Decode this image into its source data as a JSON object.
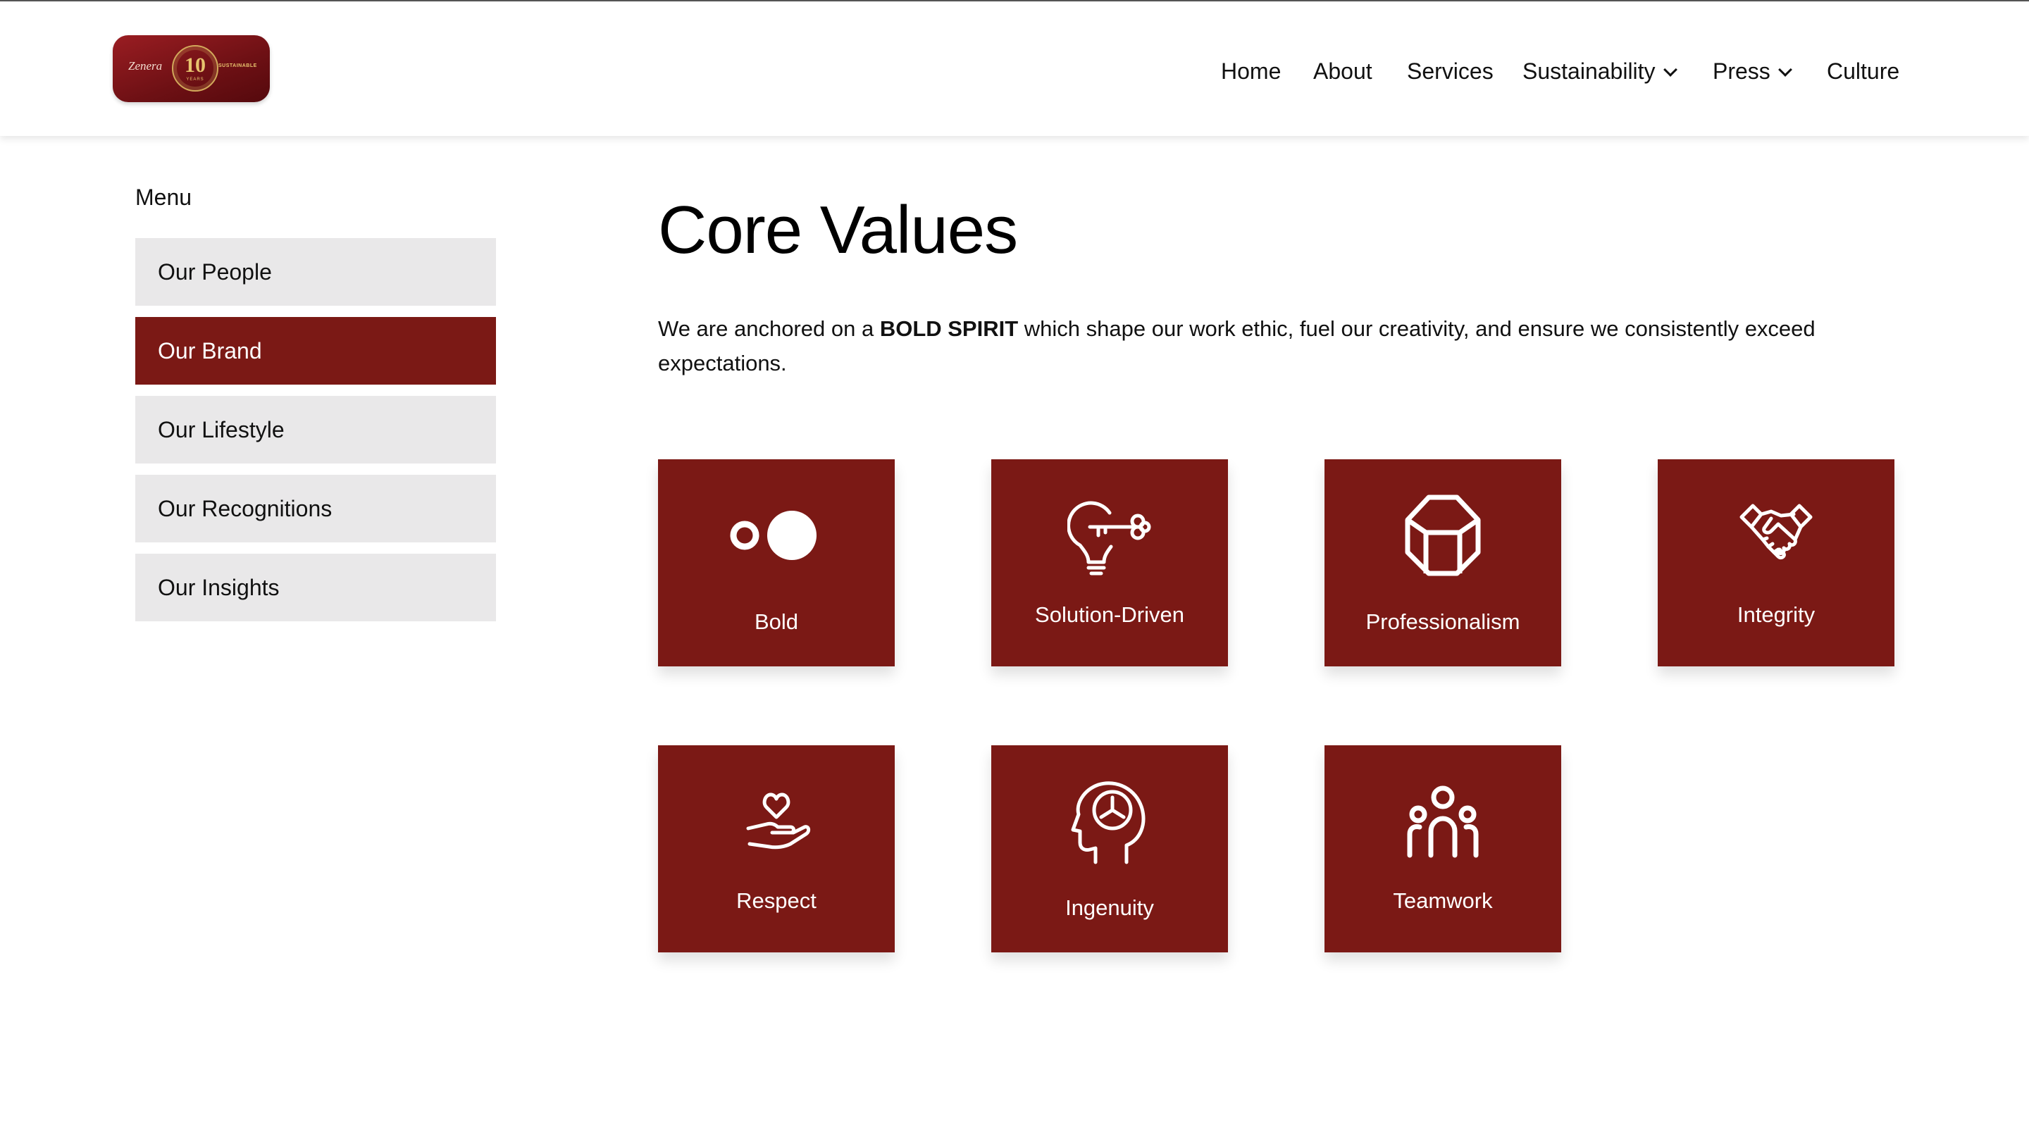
{
  "brand": {
    "logo_text": "Zenera",
    "logo_number": "10",
    "logo_years": "YEARS",
    "logo_tagline": "SUSTAINABLE"
  },
  "nav": {
    "items": [
      {
        "label": "Home"
      },
      {
        "label": "About"
      },
      {
        "label": "Services"
      },
      {
        "label": "Sustainability",
        "has_dropdown": true
      },
      {
        "label": "Press",
        "has_dropdown": true
      },
      {
        "label": "Culture"
      }
    ]
  },
  "sidebar": {
    "title": "Menu",
    "items": [
      {
        "label": "Our People",
        "active": false
      },
      {
        "label": "Our Brand",
        "active": true
      },
      {
        "label": "Our Lifestyle",
        "active": false
      },
      {
        "label": "Our Recognitions",
        "active": false
      },
      {
        "label": "Our Insights",
        "active": false
      }
    ]
  },
  "main": {
    "title": "Core Values",
    "intro_before": "We are anchored on a ",
    "intro_bold": "BOLD SPIRIT",
    "intro_after": " which shape our work ethic, fuel our creativity, and ensure we consistently exceed expectations.",
    "values": [
      {
        "label": "Bold",
        "icon": "bold-dots-icon"
      },
      {
        "label": "Solution-Driven",
        "icon": "lightbulb-key-icon"
      },
      {
        "label": "Professionalism",
        "icon": "hexagon-cube-icon"
      },
      {
        "label": "Integrity",
        "icon": "handshake-icon"
      },
      {
        "label": "Respect",
        "icon": "heart-hand-icon"
      },
      {
        "label": "Ingenuity",
        "icon": "head-gear-icon"
      },
      {
        "label": "Teamwork",
        "icon": "team-people-icon"
      }
    ]
  },
  "colors": {
    "brand_red": "#7b1915",
    "sidebar_bg": "#e9e8e9",
    "logo_gold": "#e8c46e"
  }
}
